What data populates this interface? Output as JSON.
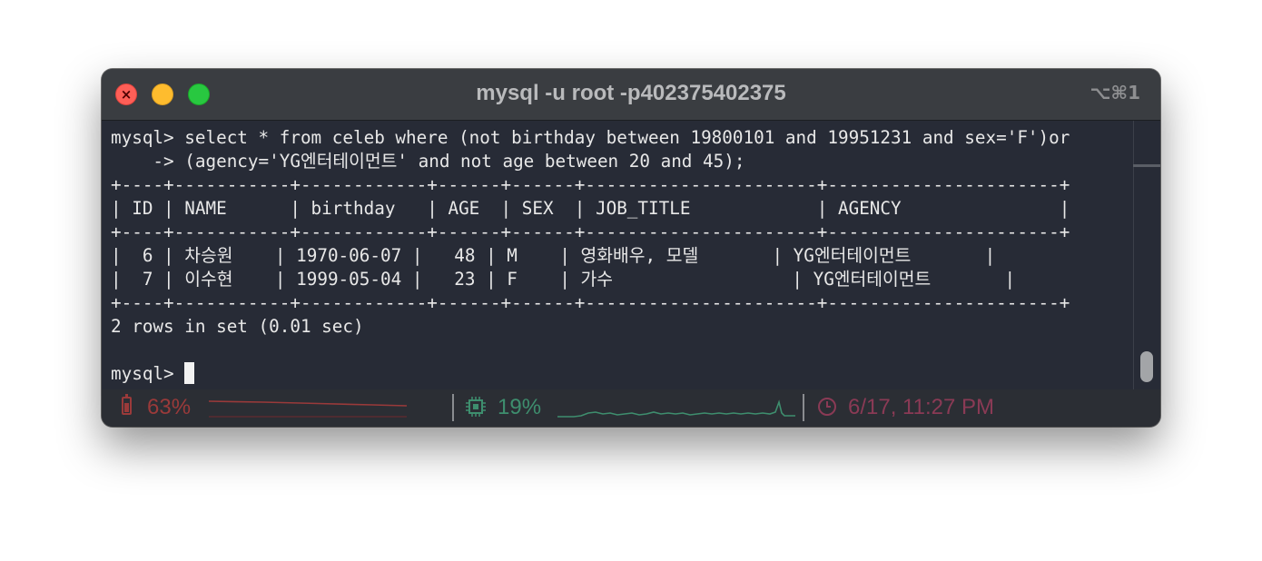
{
  "window": {
    "title": "mysql -u root -p402375402375",
    "shortcut": "⌥⌘1",
    "close_glyph": "×"
  },
  "terminal": {
    "lines": [
      "mysql> select * from celeb where (not birthday between 19800101 and 19951231 and sex='F')or",
      "    -> (agency='YG엔터테이먼트' and not age between 20 and 45);",
      "+----+-----------+------------+------+------+----------------------+----------------------+",
      "| ID | NAME      | birthday   | AGE  | SEX  | JOB_TITLE            | AGENCY               |",
      "+----+-----------+------------+------+------+----------------------+----------------------+",
      "|  6 | 차승원    | 1970-06-07 |   48 | M    | 영화배우, 모델       | YG엔터테이먼트       |",
      "|  7 | 이수현    | 1999-05-04 |   23 | F    | 가수                 | YG엔터테이먼트       |",
      "+----+-----------+------------+------+------+----------------------+----------------------+",
      "2 rows in set (0.01 sec)",
      ""
    ],
    "prompt": "mysql> "
  },
  "statusbar": {
    "battery": {
      "text": "63%",
      "color": "#9a3a3a",
      "icon": "battery-icon"
    },
    "cpu": {
      "text": "19%",
      "color": "#3e8e6e",
      "icon": "cpu-icon"
    },
    "clock": {
      "text": "6/17, 11:27 PM",
      "color": "#8a3a55",
      "icon": "clock-icon"
    }
  },
  "colors": {
    "terminal_bg": "#272b36",
    "terminal_fg": "#e8e8e8",
    "titlebar_bg": "#3a3d41",
    "statusbar_bg": "#2b2e34"
  }
}
